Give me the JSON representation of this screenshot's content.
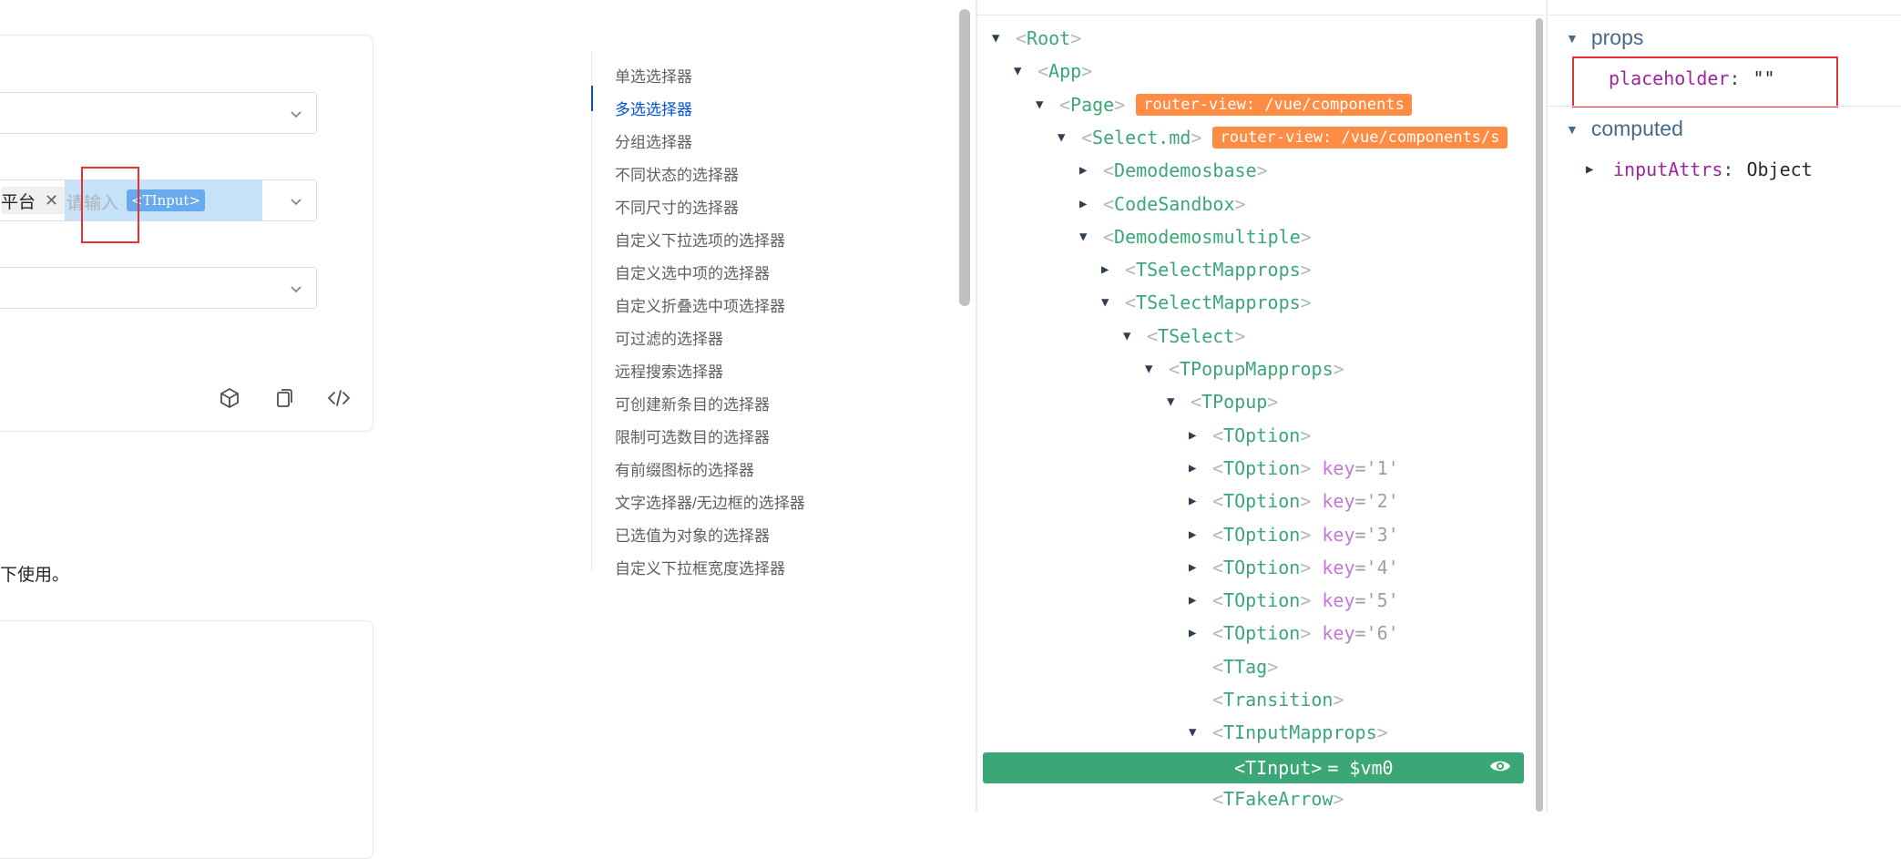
{
  "demo": {
    "tag_text": "平台",
    "tag_close": "✕",
    "input_placeholder": "请输入",
    "tinput_label": "<TInput>",
    "note_text": "下使用。"
  },
  "anchor_nav": {
    "items": [
      {
        "label": "单选选择器",
        "active": false
      },
      {
        "label": "多选选择器",
        "active": true
      },
      {
        "label": "分组选择器",
        "active": false
      },
      {
        "label": "不同状态的选择器",
        "active": false
      },
      {
        "label": "不同尺寸的选择器",
        "active": false
      },
      {
        "label": "自定义下拉选项的选择器",
        "active": false
      },
      {
        "label": "自定义选中项的选择器",
        "active": false
      },
      {
        "label": "自定义折叠选中项选择器",
        "active": false
      },
      {
        "label": "可过滤的选择器",
        "active": false
      },
      {
        "label": "远程搜索选择器",
        "active": false
      },
      {
        "label": "可创建新条目的选择器",
        "active": false
      },
      {
        "label": "限制可选数目的选择器",
        "active": false
      },
      {
        "label": "有前缀图标的选择器",
        "active": false
      },
      {
        "label": "文字选择器/无边框的选择器",
        "active": false
      },
      {
        "label": "已选值为对象的选择器",
        "active": false
      },
      {
        "label": "自定义下拉框宽度选择器",
        "active": false
      }
    ]
  },
  "tree": {
    "nodes": [
      {
        "name": "Root",
        "expand": "open"
      },
      {
        "name": "App",
        "expand": "open"
      },
      {
        "name": "Page",
        "expand": "open",
        "badge": "router-view: /vue/components"
      },
      {
        "name": "Select.md",
        "expand": "open",
        "badge": "router-view: /vue/components/s"
      },
      {
        "name": "Demodemosbase",
        "expand": "closed"
      },
      {
        "name": "CodeSandbox",
        "expand": "closed"
      },
      {
        "name": "Demodemosmultiple",
        "expand": "open"
      },
      {
        "name": "TSelectMapprops",
        "expand": "closed"
      },
      {
        "name": "TSelectMapprops",
        "expand": "open"
      },
      {
        "name": "TSelect",
        "expand": "open"
      },
      {
        "name": "TPopupMapprops",
        "expand": "open"
      },
      {
        "name": "TPopup",
        "expand": "open"
      },
      {
        "name": "TOption",
        "expand": "closed"
      },
      {
        "name": "TOption",
        "expand": "closed",
        "key": "key",
        "keyval": "='1'"
      },
      {
        "name": "TOption",
        "expand": "closed",
        "key": "key",
        "keyval": "='2'"
      },
      {
        "name": "TOption",
        "expand": "closed",
        "key": "key",
        "keyval": "='3'"
      },
      {
        "name": "TOption",
        "expand": "closed",
        "key": "key",
        "keyval": "='4'"
      },
      {
        "name": "TOption",
        "expand": "closed",
        "key": "key",
        "keyval": "='5'"
      },
      {
        "name": "TOption",
        "expand": "closed",
        "key": "key",
        "keyval": "='6'"
      },
      {
        "name": "TTag",
        "expand": "none"
      },
      {
        "name": "Transition",
        "expand": "none"
      },
      {
        "name": "TInputMapprops",
        "expand": "open"
      },
      {
        "name": "TInput",
        "expand": "none",
        "selected": true,
        "vm": "= $vm0"
      },
      {
        "name": "TFakeArrow",
        "expand": "none"
      }
    ]
  },
  "state": {
    "props_title": "props",
    "props": [
      {
        "key": "placeholder",
        "value": "\"\""
      }
    ],
    "computed_title": "computed",
    "computed": [
      {
        "key": "inputAttrs",
        "value": "Object"
      }
    ]
  },
  "colors": {
    "component_green": "#3ba776",
    "badge_orange": "#ff8c45",
    "selection_blue": "#c6e2f9",
    "annotation_red": "#e83232",
    "active_link": "#0052d9"
  },
  "icons": [
    "chevron-down-icon",
    "close-icon",
    "cube-icon",
    "copy-icon",
    "code-icon",
    "eye-icon",
    "triangle-down-icon",
    "triangle-right-icon"
  ]
}
